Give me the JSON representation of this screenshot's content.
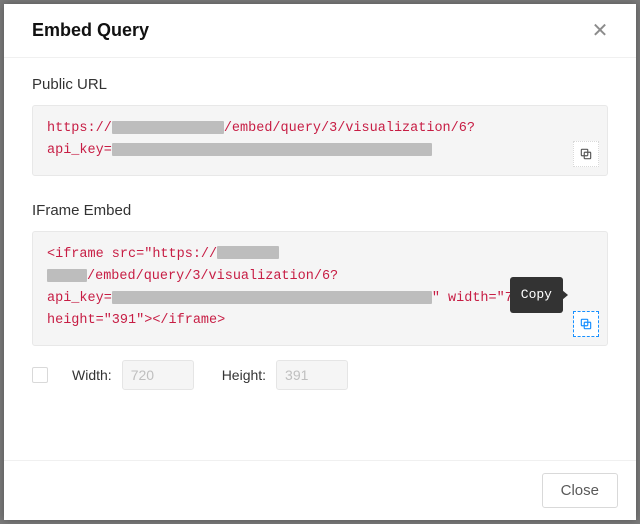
{
  "modal": {
    "title": "Embed Query",
    "close_button": "Close",
    "tooltip_copy": "Copy"
  },
  "public_url": {
    "label": "Public URL",
    "scheme": "https://",
    "path": "/embed/query/3/visualization/6?",
    "param_key": "api_key="
  },
  "iframe": {
    "label": "IFrame Embed",
    "open_tag": "<iframe src=\"https://",
    "path": "/embed/query/3/visualization/6?",
    "param_key": "api_key=",
    "after_key": "\" width=\"720\"",
    "line4": "height=\"391\"></iframe>"
  },
  "controls": {
    "width_label": "Width:",
    "height_label": "Height:",
    "width_value": "720",
    "height_value": "391"
  }
}
